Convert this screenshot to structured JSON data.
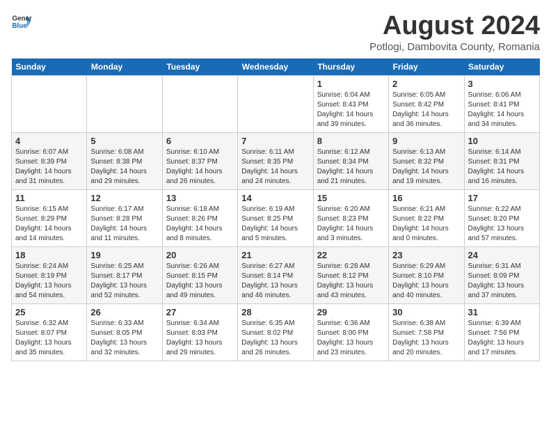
{
  "header": {
    "logo_general": "General",
    "logo_blue": "Blue",
    "title": "August 2024",
    "subtitle": "Potlogi, Dambovita County, Romania"
  },
  "weekdays": [
    "Sunday",
    "Monday",
    "Tuesday",
    "Wednesday",
    "Thursday",
    "Friday",
    "Saturday"
  ],
  "weeks": [
    [
      {
        "day": "",
        "detail": ""
      },
      {
        "day": "",
        "detail": ""
      },
      {
        "day": "",
        "detail": ""
      },
      {
        "day": "",
        "detail": ""
      },
      {
        "day": "1",
        "detail": "Sunrise: 6:04 AM\nSunset: 8:43 PM\nDaylight: 14 hours\nand 39 minutes."
      },
      {
        "day": "2",
        "detail": "Sunrise: 6:05 AM\nSunset: 8:42 PM\nDaylight: 14 hours\nand 36 minutes."
      },
      {
        "day": "3",
        "detail": "Sunrise: 6:06 AM\nSunset: 8:41 PM\nDaylight: 14 hours\nand 34 minutes."
      }
    ],
    [
      {
        "day": "4",
        "detail": "Sunrise: 6:07 AM\nSunset: 8:39 PM\nDaylight: 14 hours\nand 31 minutes."
      },
      {
        "day": "5",
        "detail": "Sunrise: 6:08 AM\nSunset: 8:38 PM\nDaylight: 14 hours\nand 29 minutes."
      },
      {
        "day": "6",
        "detail": "Sunrise: 6:10 AM\nSunset: 8:37 PM\nDaylight: 14 hours\nand 26 minutes."
      },
      {
        "day": "7",
        "detail": "Sunrise: 6:11 AM\nSunset: 8:35 PM\nDaylight: 14 hours\nand 24 minutes."
      },
      {
        "day": "8",
        "detail": "Sunrise: 6:12 AM\nSunset: 8:34 PM\nDaylight: 14 hours\nand 21 minutes."
      },
      {
        "day": "9",
        "detail": "Sunrise: 6:13 AM\nSunset: 8:32 PM\nDaylight: 14 hours\nand 19 minutes."
      },
      {
        "day": "10",
        "detail": "Sunrise: 6:14 AM\nSunset: 8:31 PM\nDaylight: 14 hours\nand 16 minutes."
      }
    ],
    [
      {
        "day": "11",
        "detail": "Sunrise: 6:15 AM\nSunset: 8:29 PM\nDaylight: 14 hours\nand 14 minutes."
      },
      {
        "day": "12",
        "detail": "Sunrise: 6:17 AM\nSunset: 8:28 PM\nDaylight: 14 hours\nand 11 minutes."
      },
      {
        "day": "13",
        "detail": "Sunrise: 6:18 AM\nSunset: 8:26 PM\nDaylight: 14 hours\nand 8 minutes."
      },
      {
        "day": "14",
        "detail": "Sunrise: 6:19 AM\nSunset: 8:25 PM\nDaylight: 14 hours\nand 5 minutes."
      },
      {
        "day": "15",
        "detail": "Sunrise: 6:20 AM\nSunset: 8:23 PM\nDaylight: 14 hours\nand 3 minutes."
      },
      {
        "day": "16",
        "detail": "Sunrise: 6:21 AM\nSunset: 8:22 PM\nDaylight: 14 hours\nand 0 minutes."
      },
      {
        "day": "17",
        "detail": "Sunrise: 6:22 AM\nSunset: 8:20 PM\nDaylight: 13 hours\nand 57 minutes."
      }
    ],
    [
      {
        "day": "18",
        "detail": "Sunrise: 6:24 AM\nSunset: 8:19 PM\nDaylight: 13 hours\nand 54 minutes."
      },
      {
        "day": "19",
        "detail": "Sunrise: 6:25 AM\nSunset: 8:17 PM\nDaylight: 13 hours\nand 52 minutes."
      },
      {
        "day": "20",
        "detail": "Sunrise: 6:26 AM\nSunset: 8:15 PM\nDaylight: 13 hours\nand 49 minutes."
      },
      {
        "day": "21",
        "detail": "Sunrise: 6:27 AM\nSunset: 8:14 PM\nDaylight: 13 hours\nand 46 minutes."
      },
      {
        "day": "22",
        "detail": "Sunrise: 6:28 AM\nSunset: 8:12 PM\nDaylight: 13 hours\nand 43 minutes."
      },
      {
        "day": "23",
        "detail": "Sunrise: 6:29 AM\nSunset: 8:10 PM\nDaylight: 13 hours\nand 40 minutes."
      },
      {
        "day": "24",
        "detail": "Sunrise: 6:31 AM\nSunset: 8:09 PM\nDaylight: 13 hours\nand 37 minutes."
      }
    ],
    [
      {
        "day": "25",
        "detail": "Sunrise: 6:32 AM\nSunset: 8:07 PM\nDaylight: 13 hours\nand 35 minutes."
      },
      {
        "day": "26",
        "detail": "Sunrise: 6:33 AM\nSunset: 8:05 PM\nDaylight: 13 hours\nand 32 minutes."
      },
      {
        "day": "27",
        "detail": "Sunrise: 6:34 AM\nSunset: 8:03 PM\nDaylight: 13 hours\nand 29 minutes."
      },
      {
        "day": "28",
        "detail": "Sunrise: 6:35 AM\nSunset: 8:02 PM\nDaylight: 13 hours\nand 26 minutes."
      },
      {
        "day": "29",
        "detail": "Sunrise: 6:36 AM\nSunset: 8:00 PM\nDaylight: 13 hours\nand 23 minutes."
      },
      {
        "day": "30",
        "detail": "Sunrise: 6:38 AM\nSunset: 7:58 PM\nDaylight: 13 hours\nand 20 minutes."
      },
      {
        "day": "31",
        "detail": "Sunrise: 6:39 AM\nSunset: 7:56 PM\nDaylight: 13 hours\nand 17 minutes."
      }
    ]
  ]
}
